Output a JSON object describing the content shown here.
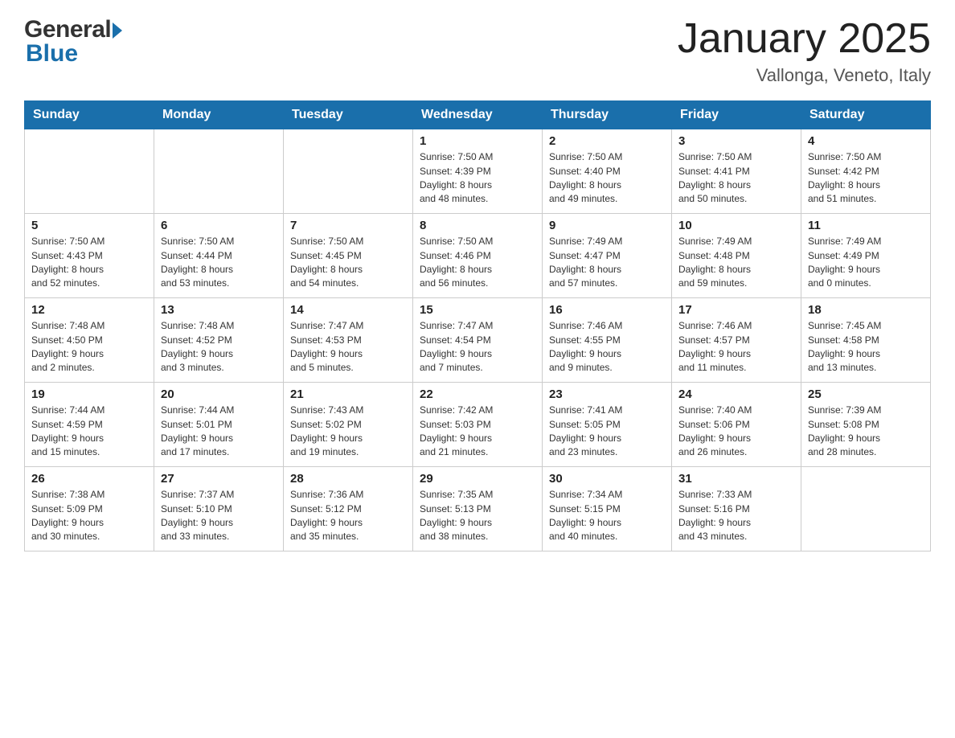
{
  "header": {
    "logo_general": "General",
    "logo_blue": "Blue",
    "title": "January 2025",
    "location": "Vallonga, Veneto, Italy"
  },
  "weekdays": [
    "Sunday",
    "Monday",
    "Tuesday",
    "Wednesday",
    "Thursday",
    "Friday",
    "Saturday"
  ],
  "weeks": [
    [
      {
        "day": "",
        "info": ""
      },
      {
        "day": "",
        "info": ""
      },
      {
        "day": "",
        "info": ""
      },
      {
        "day": "1",
        "info": "Sunrise: 7:50 AM\nSunset: 4:39 PM\nDaylight: 8 hours\nand 48 minutes."
      },
      {
        "day": "2",
        "info": "Sunrise: 7:50 AM\nSunset: 4:40 PM\nDaylight: 8 hours\nand 49 minutes."
      },
      {
        "day": "3",
        "info": "Sunrise: 7:50 AM\nSunset: 4:41 PM\nDaylight: 8 hours\nand 50 minutes."
      },
      {
        "day": "4",
        "info": "Sunrise: 7:50 AM\nSunset: 4:42 PM\nDaylight: 8 hours\nand 51 minutes."
      }
    ],
    [
      {
        "day": "5",
        "info": "Sunrise: 7:50 AM\nSunset: 4:43 PM\nDaylight: 8 hours\nand 52 minutes."
      },
      {
        "day": "6",
        "info": "Sunrise: 7:50 AM\nSunset: 4:44 PM\nDaylight: 8 hours\nand 53 minutes."
      },
      {
        "day": "7",
        "info": "Sunrise: 7:50 AM\nSunset: 4:45 PM\nDaylight: 8 hours\nand 54 minutes."
      },
      {
        "day": "8",
        "info": "Sunrise: 7:50 AM\nSunset: 4:46 PM\nDaylight: 8 hours\nand 56 minutes."
      },
      {
        "day": "9",
        "info": "Sunrise: 7:49 AM\nSunset: 4:47 PM\nDaylight: 8 hours\nand 57 minutes."
      },
      {
        "day": "10",
        "info": "Sunrise: 7:49 AM\nSunset: 4:48 PM\nDaylight: 8 hours\nand 59 minutes."
      },
      {
        "day": "11",
        "info": "Sunrise: 7:49 AM\nSunset: 4:49 PM\nDaylight: 9 hours\nand 0 minutes."
      }
    ],
    [
      {
        "day": "12",
        "info": "Sunrise: 7:48 AM\nSunset: 4:50 PM\nDaylight: 9 hours\nand 2 minutes."
      },
      {
        "day": "13",
        "info": "Sunrise: 7:48 AM\nSunset: 4:52 PM\nDaylight: 9 hours\nand 3 minutes."
      },
      {
        "day": "14",
        "info": "Sunrise: 7:47 AM\nSunset: 4:53 PM\nDaylight: 9 hours\nand 5 minutes."
      },
      {
        "day": "15",
        "info": "Sunrise: 7:47 AM\nSunset: 4:54 PM\nDaylight: 9 hours\nand 7 minutes."
      },
      {
        "day": "16",
        "info": "Sunrise: 7:46 AM\nSunset: 4:55 PM\nDaylight: 9 hours\nand 9 minutes."
      },
      {
        "day": "17",
        "info": "Sunrise: 7:46 AM\nSunset: 4:57 PM\nDaylight: 9 hours\nand 11 minutes."
      },
      {
        "day": "18",
        "info": "Sunrise: 7:45 AM\nSunset: 4:58 PM\nDaylight: 9 hours\nand 13 minutes."
      }
    ],
    [
      {
        "day": "19",
        "info": "Sunrise: 7:44 AM\nSunset: 4:59 PM\nDaylight: 9 hours\nand 15 minutes."
      },
      {
        "day": "20",
        "info": "Sunrise: 7:44 AM\nSunset: 5:01 PM\nDaylight: 9 hours\nand 17 minutes."
      },
      {
        "day": "21",
        "info": "Sunrise: 7:43 AM\nSunset: 5:02 PM\nDaylight: 9 hours\nand 19 minutes."
      },
      {
        "day": "22",
        "info": "Sunrise: 7:42 AM\nSunset: 5:03 PM\nDaylight: 9 hours\nand 21 minutes."
      },
      {
        "day": "23",
        "info": "Sunrise: 7:41 AM\nSunset: 5:05 PM\nDaylight: 9 hours\nand 23 minutes."
      },
      {
        "day": "24",
        "info": "Sunrise: 7:40 AM\nSunset: 5:06 PM\nDaylight: 9 hours\nand 26 minutes."
      },
      {
        "day": "25",
        "info": "Sunrise: 7:39 AM\nSunset: 5:08 PM\nDaylight: 9 hours\nand 28 minutes."
      }
    ],
    [
      {
        "day": "26",
        "info": "Sunrise: 7:38 AM\nSunset: 5:09 PM\nDaylight: 9 hours\nand 30 minutes."
      },
      {
        "day": "27",
        "info": "Sunrise: 7:37 AM\nSunset: 5:10 PM\nDaylight: 9 hours\nand 33 minutes."
      },
      {
        "day": "28",
        "info": "Sunrise: 7:36 AM\nSunset: 5:12 PM\nDaylight: 9 hours\nand 35 minutes."
      },
      {
        "day": "29",
        "info": "Sunrise: 7:35 AM\nSunset: 5:13 PM\nDaylight: 9 hours\nand 38 minutes."
      },
      {
        "day": "30",
        "info": "Sunrise: 7:34 AM\nSunset: 5:15 PM\nDaylight: 9 hours\nand 40 minutes."
      },
      {
        "day": "31",
        "info": "Sunrise: 7:33 AM\nSunset: 5:16 PM\nDaylight: 9 hours\nand 43 minutes."
      },
      {
        "day": "",
        "info": ""
      }
    ]
  ]
}
